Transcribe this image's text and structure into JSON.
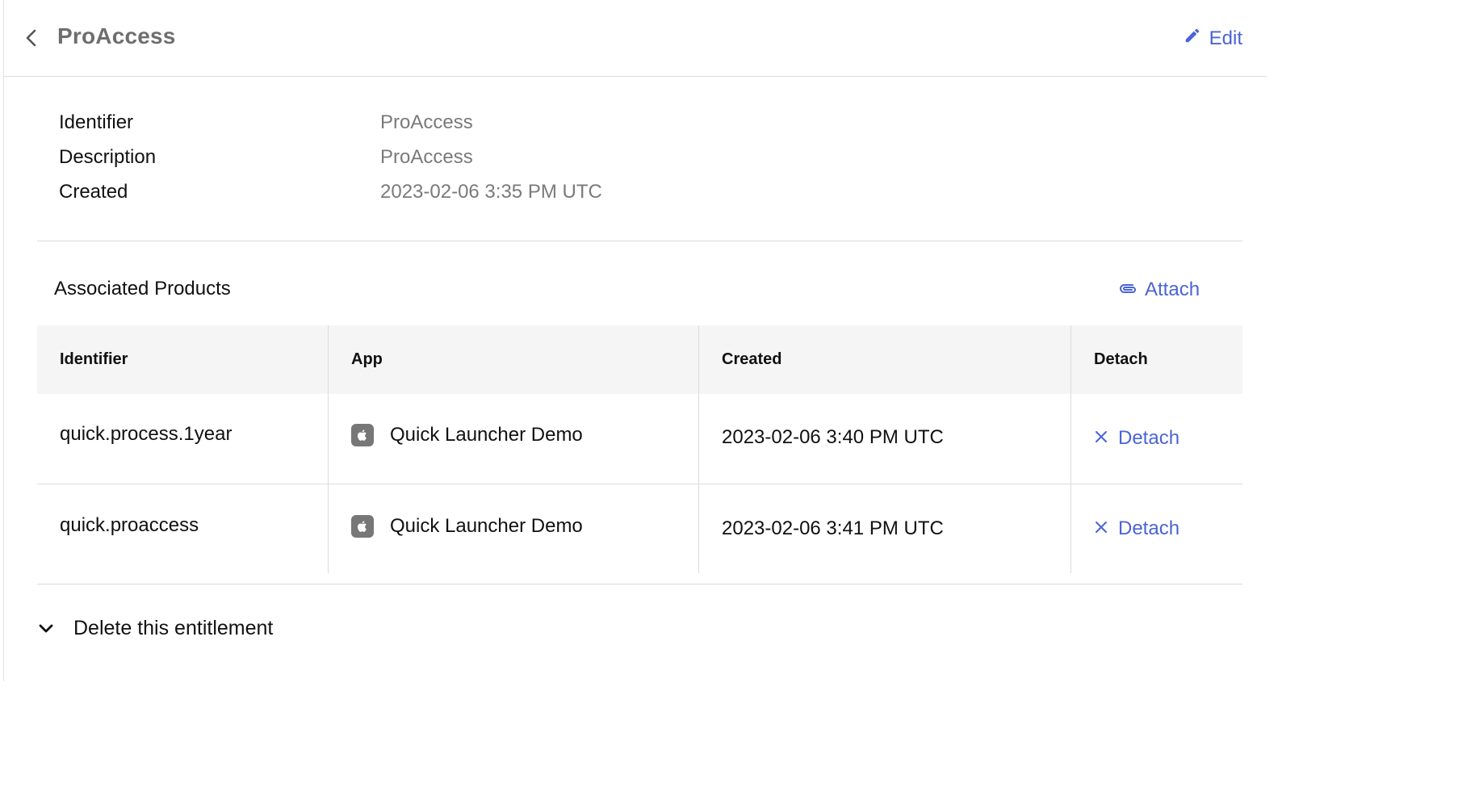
{
  "header": {
    "title": "ProAccess",
    "edit_label": "Edit"
  },
  "details": [
    {
      "label": "Identifier",
      "value": "ProAccess"
    },
    {
      "label": "Description",
      "value": "ProAccess"
    },
    {
      "label": "Created",
      "value": "2023-02-06 3:35 PM UTC"
    }
  ],
  "products": {
    "title": "Associated Products",
    "attach_label": "Attach",
    "columns": [
      "Identifier",
      "App",
      "Created",
      "Detach"
    ],
    "rows": [
      {
        "identifier": "quick.process.1year",
        "app": "Quick Launcher Demo",
        "app_icon": "apple-icon",
        "created": "2023-02-06 3:40 PM UTC",
        "detach_label": "Detach"
      },
      {
        "identifier": "quick.proaccess",
        "app": "Quick Launcher Demo",
        "app_icon": "apple-icon",
        "created": "2023-02-06 3:41 PM UTC",
        "detach_label": "Detach"
      }
    ]
  },
  "danger": {
    "toggle_label": "Delete this entitlement"
  },
  "colors": {
    "accent": "#4a64d6",
    "muted_text": "#7a7a7a",
    "header_bg": "#f5f5f5",
    "border": "#dcdcdc"
  },
  "icons": {
    "back": "chevron-left-icon",
    "edit": "pencil-icon",
    "attach": "paperclip-icon",
    "detach": "close-icon",
    "toggle": "chevron-down-icon"
  }
}
